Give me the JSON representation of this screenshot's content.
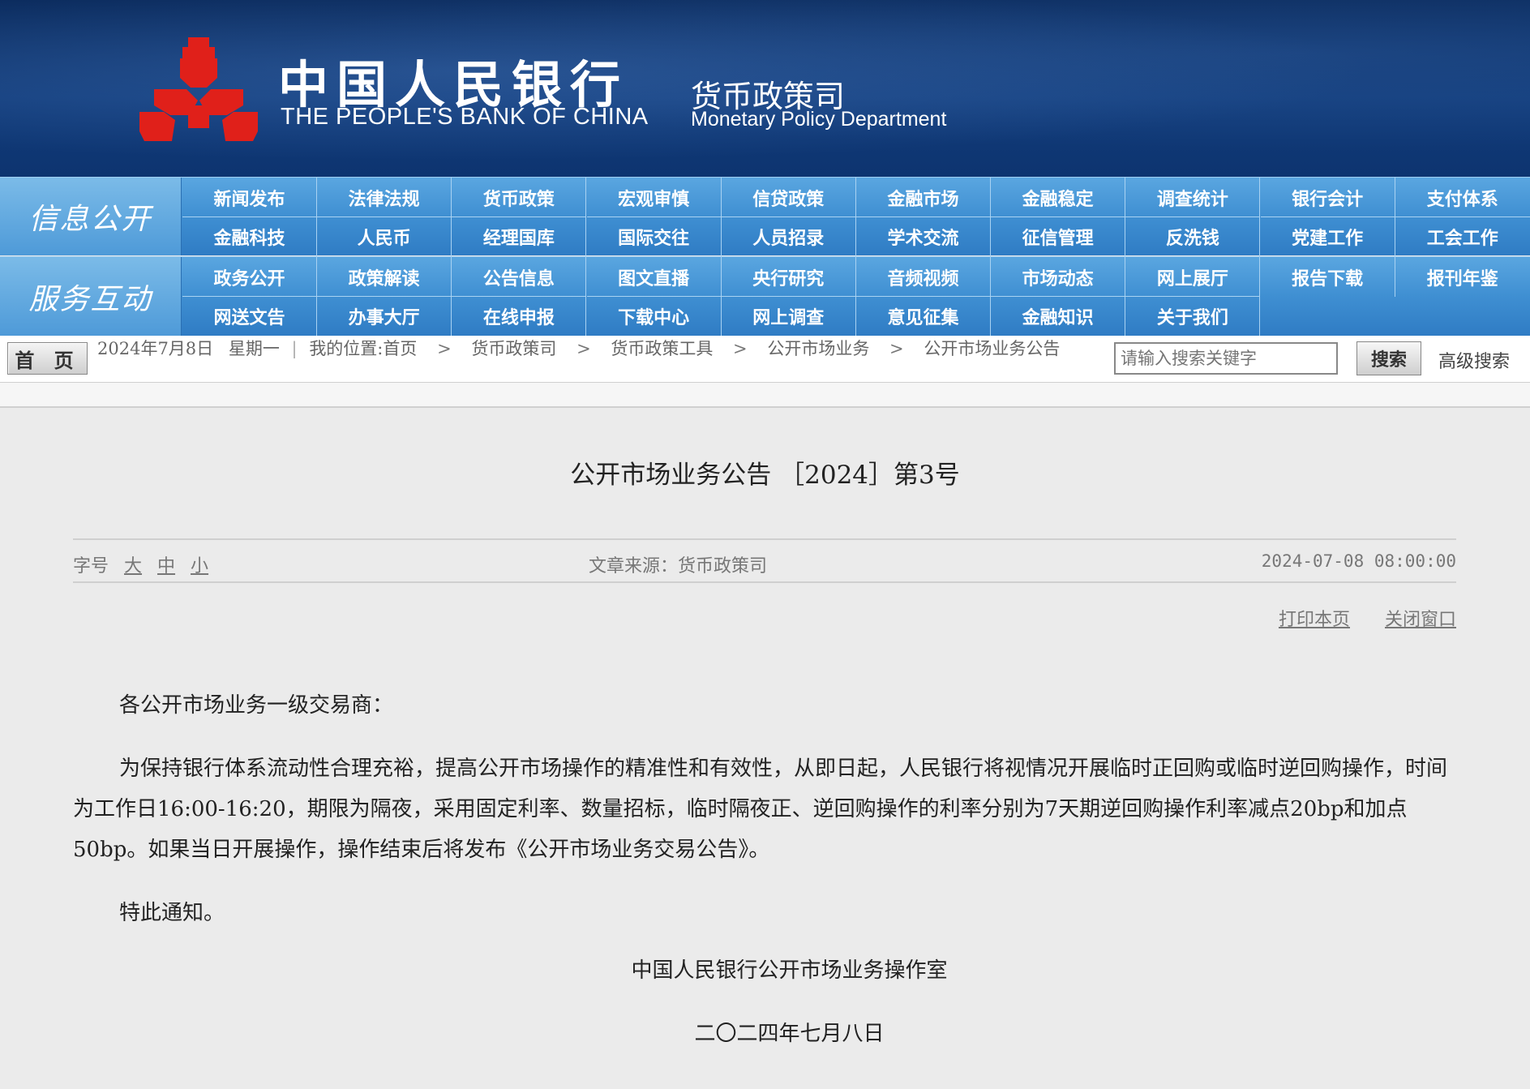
{
  "header": {
    "bank_name_cn": "中国人民银行",
    "bank_name_en": "THE PEOPLE'S BANK OF CHINA",
    "dept_cn": "货币政策司",
    "dept_en": "Monetary Policy Department",
    "colors": {
      "banner": "#123c7a",
      "logo": "#e0201a"
    }
  },
  "nav": {
    "row1": {
      "label": "信息公开",
      "top": [
        "新闻发布",
        "法律法规",
        "货币政策",
        "宏观审慎",
        "信贷政策",
        "金融市场",
        "金融稳定",
        "调查统计",
        "银行会计",
        "支付体系"
      ],
      "bottom": [
        "金融科技",
        "人民币",
        "经理国库",
        "国际交往",
        "人员招录",
        "学术交流",
        "征信管理",
        "反洗钱",
        "党建工作",
        "工会工作"
      ]
    },
    "row2": {
      "label": "服务互动",
      "top": [
        "政务公开",
        "政策解读",
        "公告信息",
        "图文直播",
        "央行研究",
        "音频视频",
        "市场动态",
        "网上展厅",
        "报告下载",
        "报刊年鉴"
      ],
      "bottom": [
        "网送文告",
        "办事大厅",
        "在线申报",
        "下载中心",
        "网上调查",
        "意见征集",
        "金融知识",
        "关于我们"
      ]
    }
  },
  "crumbbar": {
    "home": "首 页",
    "date": "2024年7月8日",
    "weekday": "星期一",
    "location_label": "我的位置:首页",
    "crumbs": [
      "货币政策司",
      "货币政策工具",
      "公开市场业务",
      "公开市场业务公告"
    ],
    "search_placeholder": "请输入搜索关键字",
    "search_btn": "搜索",
    "advanced": "高级搜索"
  },
  "article": {
    "title": "公开市场业务公告 ［2024］第3号",
    "font_size_label": "字号",
    "font_sizes": [
      "大",
      "中",
      "小"
    ],
    "source": "文章来源：货币政策司",
    "datetime": "2024-07-08 08:00:00",
    "print": "打印本页",
    "close": "关闭窗口",
    "salutation": "各公开市场业务一级交易商：",
    "body": "为保持银行体系流动性合理充裕，提高公开市场操作的精准性和有效性，从即日起，人民银行将视情况开展临时正回购或临时逆回购操作，时间为工作日16:00-16:20，期限为隔夜，采用固定利率、数量招标，临时隔夜正、逆回购操作的利率分别为7天期逆回购操作利率减点20bp和加点50bp。如果当日开展操作，操作结束后将发布《公开市场业务交易公告》。",
    "closing": "特此通知。",
    "signature": "中国人民银行公开市场业务操作室",
    "sign_date": "二〇二四年七月八日"
  }
}
